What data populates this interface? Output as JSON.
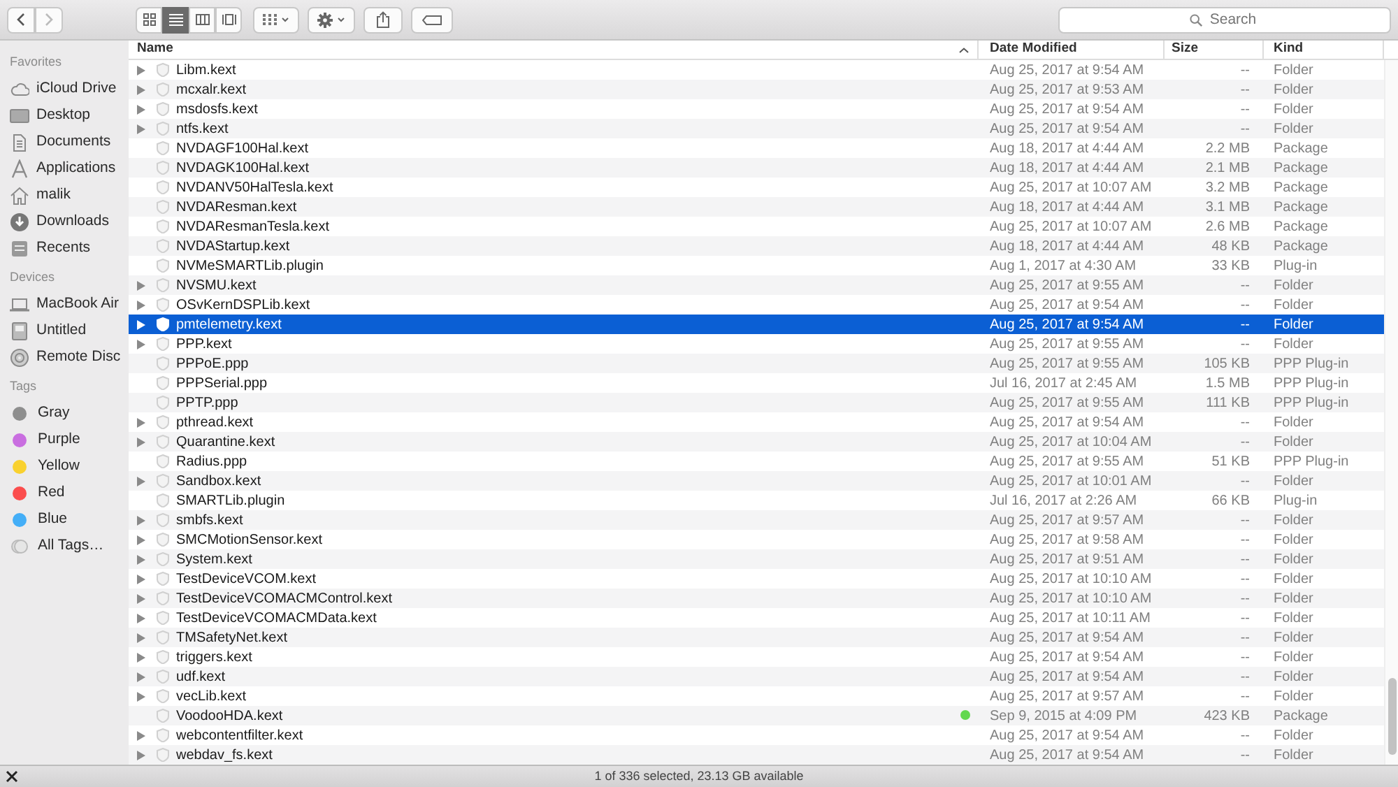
{
  "toolbar": {
    "view_modes": [
      {
        "selected": false
      },
      {
        "selected": true
      },
      {
        "selected": false
      },
      {
        "selected": false
      }
    ],
    "search": {
      "placeholder": "Search"
    }
  },
  "sidebar": {
    "sections": [
      {
        "heading": "Favorites",
        "items": [
          {
            "label": "iCloud Drive"
          },
          {
            "label": "Desktop"
          },
          {
            "label": "Documents"
          },
          {
            "label": "Applications"
          },
          {
            "label": "malik"
          },
          {
            "label": "Downloads"
          },
          {
            "label": "Recents"
          }
        ]
      },
      {
        "heading": "Devices",
        "items": [
          {
            "label": "MacBook Air"
          },
          {
            "label": "Untitled"
          },
          {
            "label": "Remote Disc"
          }
        ]
      },
      {
        "heading": "Tags",
        "items": [
          {
            "label": "Gray",
            "color": "#8e8e8e"
          },
          {
            "label": "Purple",
            "color": "#c96ee0"
          },
          {
            "label": "Yellow",
            "color": "#f9d12f"
          },
          {
            "label": "Red",
            "color": "#fb4d4d"
          },
          {
            "label": "Blue",
            "color": "#44aef7"
          },
          {
            "label": "All Tags…",
            "kind": "all"
          }
        ]
      }
    ]
  },
  "table": {
    "columns": [
      {
        "label": "Name",
        "sorted": true
      },
      {
        "label": "Date Modified",
        "sorted": false
      },
      {
        "label": "Size",
        "sorted": false
      },
      {
        "label": "Kind",
        "sorted": false
      }
    ],
    "rows": [
      {
        "name": "Libm.kext",
        "date": "Aug 25, 2017 at 9:54 AM",
        "size": "--",
        "kind": "Folder",
        "expandable": true,
        "selected": false
      },
      {
        "name": "mcxalr.kext",
        "date": "Aug 25, 2017 at 9:53 AM",
        "size": "--",
        "kind": "Folder",
        "expandable": true,
        "selected": false
      },
      {
        "name": "msdosfs.kext",
        "date": "Aug 25, 2017 at 9:54 AM",
        "size": "--",
        "kind": "Folder",
        "expandable": true,
        "selected": false
      },
      {
        "name": "ntfs.kext",
        "date": "Aug 25, 2017 at 9:54 AM",
        "size": "--",
        "kind": "Folder",
        "expandable": true,
        "selected": false
      },
      {
        "name": "NVDAGF100Hal.kext",
        "date": "Aug 18, 2017 at 4:44 AM",
        "size": "2.2 MB",
        "kind": "Package",
        "expandable": false,
        "selected": false
      },
      {
        "name": "NVDAGK100Hal.kext",
        "date": "Aug 18, 2017 at 4:44 AM",
        "size": "2.1 MB",
        "kind": "Package",
        "expandable": false,
        "selected": false
      },
      {
        "name": "NVDANV50HalTesla.kext",
        "date": "Aug 25, 2017 at 10:07 AM",
        "size": "3.2 MB",
        "kind": "Package",
        "expandable": false,
        "selected": false
      },
      {
        "name": "NVDAResman.kext",
        "date": "Aug 18, 2017 at 4:44 AM",
        "size": "3.1 MB",
        "kind": "Package",
        "expandable": false,
        "selected": false
      },
      {
        "name": "NVDAResmanTesla.kext",
        "date": "Aug 25, 2017 at 10:07 AM",
        "size": "2.6 MB",
        "kind": "Package",
        "expandable": false,
        "selected": false
      },
      {
        "name": "NVDAStartup.kext",
        "date": "Aug 18, 2017 at 4:44 AM",
        "size": "48 KB",
        "kind": "Package",
        "expandable": false,
        "selected": false
      },
      {
        "name": "NVMeSMARTLib.plugin",
        "date": "Aug 1, 2017 at 4:30 AM",
        "size": "33 KB",
        "kind": "Plug-in",
        "expandable": false,
        "selected": false
      },
      {
        "name": "NVSMU.kext",
        "date": "Aug 25, 2017 at 9:55 AM",
        "size": "--",
        "kind": "Folder",
        "expandable": true,
        "selected": false
      },
      {
        "name": "OSvKernDSPLib.kext",
        "date": "Aug 25, 2017 at 9:54 AM",
        "size": "--",
        "kind": "Folder",
        "expandable": true,
        "selected": false
      },
      {
        "name": "pmtelemetry.kext",
        "date": "Aug 25, 2017 at 9:54 AM",
        "size": "--",
        "kind": "Folder",
        "expandable": true,
        "selected": true
      },
      {
        "name": "PPP.kext",
        "date": "Aug 25, 2017 at 9:55 AM",
        "size": "--",
        "kind": "Folder",
        "expandable": true,
        "selected": false
      },
      {
        "name": "PPPoE.ppp",
        "date": "Aug 25, 2017 at 9:55 AM",
        "size": "105 KB",
        "kind": "PPP Plug-in",
        "expandable": false,
        "selected": false
      },
      {
        "name": "PPPSerial.ppp",
        "date": "Jul 16, 2017 at 2:45 AM",
        "size": "1.5 MB",
        "kind": "PPP Plug-in",
        "expandable": false,
        "selected": false
      },
      {
        "name": "PPTP.ppp",
        "date": "Aug 25, 2017 at 9:55 AM",
        "size": "111 KB",
        "kind": "PPP Plug-in",
        "expandable": false,
        "selected": false
      },
      {
        "name": "pthread.kext",
        "date": "Aug 25, 2017 at 9:54 AM",
        "size": "--",
        "kind": "Folder",
        "expandable": true,
        "selected": false
      },
      {
        "name": "Quarantine.kext",
        "date": "Aug 25, 2017 at 10:04 AM",
        "size": "--",
        "kind": "Folder",
        "expandable": true,
        "selected": false
      },
      {
        "name": "Radius.ppp",
        "date": "Aug 25, 2017 at 9:55 AM",
        "size": "51 KB",
        "kind": "PPP Plug-in",
        "expandable": false,
        "selected": false
      },
      {
        "name": "Sandbox.kext",
        "date": "Aug 25, 2017 at 10:01 AM",
        "size": "--",
        "kind": "Folder",
        "expandable": true,
        "selected": false
      },
      {
        "name": "SMARTLib.plugin",
        "date": "Jul 16, 2017 at 2:26 AM",
        "size": "66 KB",
        "kind": "Plug-in",
        "expandable": false,
        "selected": false
      },
      {
        "name": "smbfs.kext",
        "date": "Aug 25, 2017 at 9:57 AM",
        "size": "--",
        "kind": "Folder",
        "expandable": true,
        "selected": false
      },
      {
        "name": "SMCMotionSensor.kext",
        "date": "Aug 25, 2017 at 9:58 AM",
        "size": "--",
        "kind": "Folder",
        "expandable": true,
        "selected": false
      },
      {
        "name": "System.kext",
        "date": "Aug 25, 2017 at 9:51 AM",
        "size": "--",
        "kind": "Folder",
        "expandable": true,
        "selected": false
      },
      {
        "name": "TestDeviceVCOM.kext",
        "date": "Aug 25, 2017 at 10:10 AM",
        "size": "--",
        "kind": "Folder",
        "expandable": true,
        "selected": false
      },
      {
        "name": "TestDeviceVCOMACMControl.kext",
        "date": "Aug 25, 2017 at 10:10 AM",
        "size": "--",
        "kind": "Folder",
        "expandable": true,
        "selected": false
      },
      {
        "name": "TestDeviceVCOMACMData.kext",
        "date": "Aug 25, 2017 at 10:11 AM",
        "size": "--",
        "kind": "Folder",
        "expandable": true,
        "selected": false
      },
      {
        "name": "TMSafetyNet.kext",
        "date": "Aug 25, 2017 at 9:54 AM",
        "size": "--",
        "kind": "Folder",
        "expandable": true,
        "selected": false
      },
      {
        "name": "triggers.kext",
        "date": "Aug 25, 2017 at 9:54 AM",
        "size": "--",
        "kind": "Folder",
        "expandable": true,
        "selected": false
      },
      {
        "name": "udf.kext",
        "date": "Aug 25, 2017 at 9:54 AM",
        "size": "--",
        "kind": "Folder",
        "expandable": true,
        "selected": false
      },
      {
        "name": "vecLib.kext",
        "date": "Aug 25, 2017 at 9:57 AM",
        "size": "--",
        "kind": "Folder",
        "expandable": true,
        "selected": false
      },
      {
        "name": "VoodooHDA.kext",
        "date": "Sep 9, 2015 at 4:09 PM",
        "size": "423 KB",
        "kind": "Package",
        "expandable": false,
        "selected": false,
        "color": "#62d84e"
      },
      {
        "name": "webcontentfilter.kext",
        "date": "Aug 25, 2017 at 9:54 AM",
        "size": "--",
        "kind": "Folder",
        "expandable": true,
        "selected": false
      },
      {
        "name": "webdav_fs.kext",
        "date": "Aug 25, 2017 at 9:54 AM",
        "size": "--",
        "kind": "Folder",
        "expandable": true,
        "selected": false
      }
    ]
  },
  "status_bar": {
    "text": "1 of 336 selected, 23.13 GB available"
  }
}
